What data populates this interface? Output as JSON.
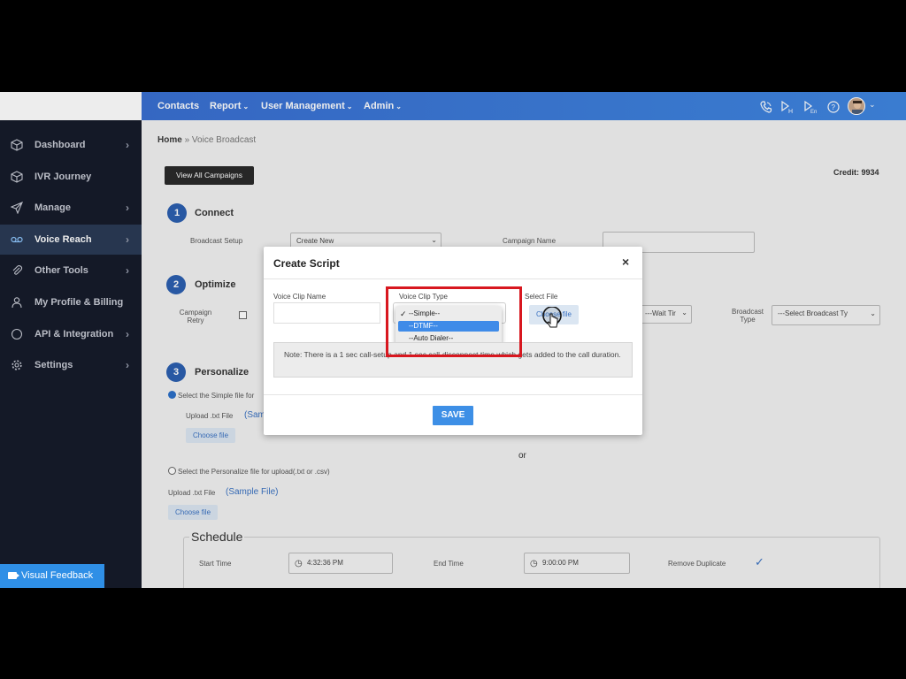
{
  "topbar": {
    "nav": [
      "Contacts",
      "Report",
      "User Management",
      "Admin"
    ],
    "nav_has_caret": [
      false,
      true,
      true,
      true
    ]
  },
  "sidebar": {
    "items": [
      {
        "label": "Dashboard",
        "icon": "cube-icon",
        "chevron": true
      },
      {
        "label": "IVR Journey",
        "icon": "box-icon",
        "chevron": false
      },
      {
        "label": "Manage",
        "icon": "send-icon",
        "chevron": true
      },
      {
        "label": "Voice Reach",
        "icon": "voicemail-icon",
        "chevron": true,
        "active": true
      },
      {
        "label": "Other Tools",
        "icon": "paperclip-icon",
        "chevron": true
      },
      {
        "label": "My Profile & Billing",
        "icon": "user-icon",
        "chevron": false
      },
      {
        "label": "API & Integration",
        "icon": "circle-icon",
        "chevron": true
      },
      {
        "label": "Settings",
        "icon": "gear-icon",
        "chevron": true
      }
    ]
  },
  "breadcrumb": {
    "home": "Home",
    "sep": "»",
    "current": "Voice Broadcast"
  },
  "page": {
    "view_all": "View All Campaigns",
    "credit": "Credit: 9934",
    "step1": {
      "num": "1",
      "title": "Connect",
      "broadcast_setup": "Broadcast Setup",
      "broadcast_value": "Create New",
      "campaign_name": "Campaign Name"
    },
    "step2": {
      "num": "2",
      "title": "Optimize",
      "campaign_retry": "Campaign Retry",
      "wait_time": "---Wait Tir",
      "broadcast_type_label": "Broadcast Type",
      "broadcast_type_value": "---Select Broadcast Ty"
    },
    "step3": {
      "num": "3",
      "title": "Personalize",
      "simple_radio": "Select the Simple file for",
      "upload_txt": "Upload .txt File",
      "sample_short": "(Sam",
      "choose_file": "Choose file",
      "or": "or",
      "personalize_radio": "Select the Personalize file for upload(.txt or .csv)",
      "upload_txt2": "Upload .txt File",
      "sample_file": "(Sample File)",
      "choose_file2": "Choose file"
    },
    "schedule": {
      "title": "Schedule",
      "start_label": "Start Time",
      "start_value": "4:32:36 PM",
      "end_label": "End Time",
      "end_value": "9:00:00 PM",
      "remove_dup": "Remove Duplicate"
    }
  },
  "modal": {
    "title": "Create Script",
    "close": "×",
    "clip_name_label": "Voice Clip Name",
    "clip_type_label": "Voice Clip Type",
    "select_file_label": "Select File",
    "options": [
      "--Simple--",
      "--DTMF--",
      "--Auto Dialer--"
    ],
    "checked_index": 0,
    "highlighted_index": 1,
    "choose_file": "Choose file",
    "note": "Note: There is a 1 sec call-setup and 1 sec call-disconnect time which gets added to the call duration.",
    "save": "SAVE"
  },
  "feedback": "Visual Feedback",
  "colors": {
    "topbar": "#3f86e0",
    "sidebar": "#161b2a",
    "accent": "#3d8fe6",
    "highlight_box": "#d8171f"
  }
}
